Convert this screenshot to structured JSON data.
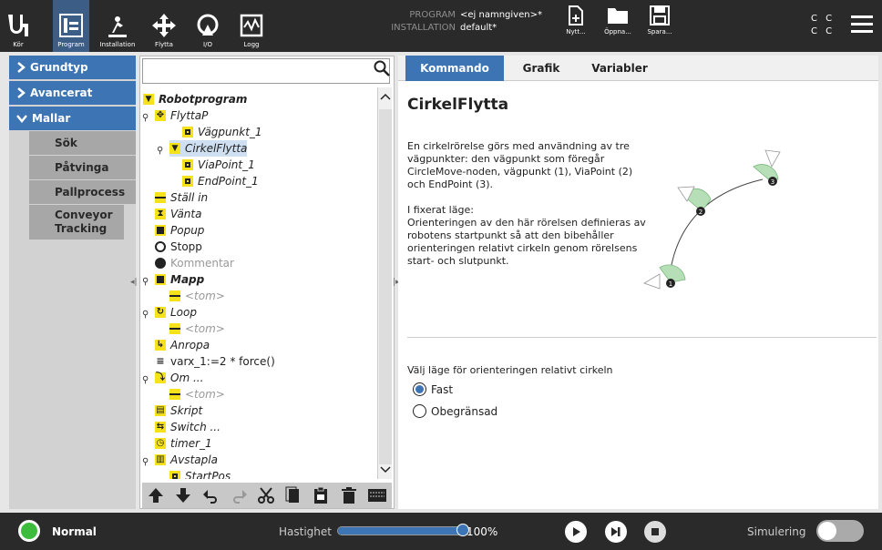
{
  "topbar": {
    "buttons": [
      {
        "label": "Kör",
        "icon": "ur-logo-icon"
      },
      {
        "label": "Program",
        "icon": "program-icon"
      },
      {
        "label": "Installation",
        "icon": "installation-icon"
      },
      {
        "label": "Flytta",
        "icon": "move-icon"
      },
      {
        "label": "I/O",
        "icon": "io-icon"
      },
      {
        "label": "Logg",
        "icon": "log-icon"
      }
    ],
    "program_label": "PROGRAM",
    "program_name": "<ej namngiven>*",
    "installation_label": "INSTALLATION",
    "installation_name": "default*",
    "file_buttons": [
      "Nytt...",
      "Öppna...",
      "Spara..."
    ],
    "cc_line1": "C C",
    "cc_line2": "C C"
  },
  "leftnav": {
    "headers": [
      "Grundtyp",
      "Avancerat",
      "Mallar"
    ],
    "items": [
      "Sök",
      "Påtvinga",
      "Pallprocess",
      "Conveyor Tracking"
    ]
  },
  "search": {
    "placeholder": ""
  },
  "tree": [
    {
      "label": "Robotprogram",
      "icon": "program-root-icon",
      "bold": true
    },
    {
      "label": "FlyttaP",
      "icon": "move-icon"
    },
    {
      "label": "Vägpunkt_1",
      "icon": "waypoint-icon"
    },
    {
      "label": "CirkelFlytta",
      "icon": "circle-move-icon",
      "selected": true
    },
    {
      "label": "ViaPoint_1",
      "icon": "waypoint-icon"
    },
    {
      "label": "EndPoint_1",
      "icon": "waypoint-icon"
    },
    {
      "label": "Ställ in",
      "icon": "set-icon"
    },
    {
      "label": "Vänta",
      "icon": "wait-icon"
    },
    {
      "label": "Popup",
      "icon": "popup-icon"
    },
    {
      "label": "Stopp",
      "icon": "stop-icon"
    },
    {
      "label": "Kommentar",
      "icon": "comment-icon"
    },
    {
      "label": "Mapp",
      "icon": "folder-icon"
    },
    {
      "label": "<tom>",
      "icon": "empty-icon"
    },
    {
      "label": "Loop",
      "icon": "loop-icon"
    },
    {
      "label": "<tom>",
      "icon": "empty-icon"
    },
    {
      "label": "Anropa",
      "icon": "call-icon"
    },
    {
      "label": "varx_1:=2 * force()",
      "icon": "assignment-icon"
    },
    {
      "label": "Om ...",
      "icon": "if-icon"
    },
    {
      "label": "<tom>",
      "icon": "empty-icon"
    },
    {
      "label": "Skript",
      "icon": "script-icon"
    },
    {
      "label": "Switch ...",
      "icon": "switch-icon"
    },
    {
      "label": "timer_1",
      "icon": "timer-icon"
    },
    {
      "label": "Avstapla",
      "icon": "stack-icon"
    },
    {
      "label": "StartPos",
      "icon": "waypoint-icon"
    }
  ],
  "tabs": [
    "Kommando",
    "Grafik",
    "Variabler"
  ],
  "right": {
    "title": "CirkelFlytta",
    "desc1": "En cirkelrörelse görs med användning av tre vägpunkter: den vägpunkt som föregår CircleMove-noden, vägpunkt (1), ViaPoint (2) och EndPoint (3).",
    "desc2a": "I fixerat läge:",
    "desc2b": "Orienteringen av den här rörelsen definieras av robotens startpunkt så att den bibehåller orienteringen relativt cirkeln genom rörelsens start- och slutpunkt.",
    "diagram_points": [
      "1",
      "2",
      "3"
    ],
    "choose_label": "Välj läge för orienteringen relativt cirkeln",
    "options": [
      {
        "label": "Fast",
        "checked": true
      },
      {
        "label": "Obegränsad",
        "checked": false
      }
    ]
  },
  "bottom": {
    "status": "Normal",
    "speed_label": "Hastighet",
    "speed_value": "100%",
    "speed_fraction": 1.0,
    "sim_label": "Simulering"
  },
  "colors": {
    "accent": "#3c74b4",
    "topbar": "#2a2a2a",
    "status_ok": "#3dbb3d",
    "tree_icon": "#f5e21a"
  }
}
